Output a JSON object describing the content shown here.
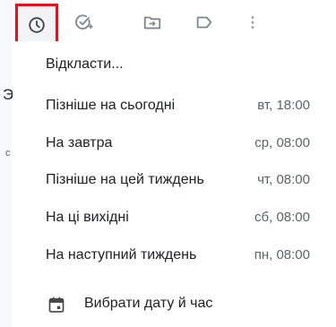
{
  "background": {
    "fragment_big": "Э",
    "fragment_small": "c"
  },
  "toolbar": {
    "snooze_icon": "clock-icon",
    "add_task_icon": "add-task-icon",
    "move_icon": "move-to-folder-icon",
    "label_icon": "label-icon",
    "more_icon": "more-vertical-icon",
    "highlight_color": "#e0131f"
  },
  "snooze_menu": {
    "title": "Відкласти...",
    "options": [
      {
        "label": "Пізніше на сьогодні",
        "time": "вт, 18:00"
      },
      {
        "label": "На завтра",
        "time": "ср, 08:00"
      },
      {
        "label": "Пізніше на цей тиждень",
        "time": "чт, 08:00"
      },
      {
        "label": "На ці вихідні",
        "time": "сб, 08:00"
      },
      {
        "label": "На наступний тиждень",
        "time": "пн, 08:00"
      }
    ],
    "pick_date_label": "Вибрати дату й час",
    "pick_date_icon": "calendar-icon"
  }
}
